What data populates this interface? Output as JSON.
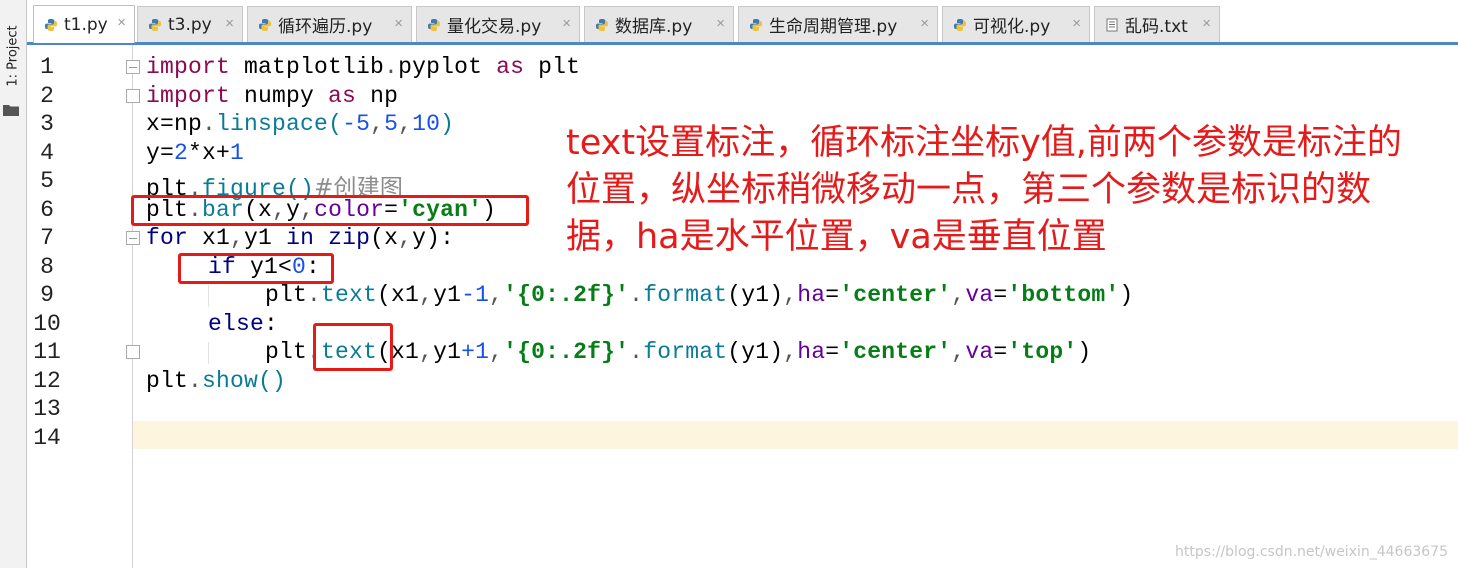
{
  "toolstrip": {
    "project_label": "1: Project"
  },
  "tabs": [
    {
      "label": "t1.py",
      "active": true,
      "icon": "python-file-icon"
    },
    {
      "label": "t3.py",
      "active": false,
      "icon": "python-file-icon"
    },
    {
      "label": "循环遍历.py",
      "active": false,
      "icon": "python-file-icon"
    },
    {
      "label": "量化交易.py",
      "active": false,
      "icon": "python-file-icon"
    },
    {
      "label": "数据库.py",
      "active": false,
      "icon": "python-file-icon"
    },
    {
      "label": "生命周期管理.py",
      "active": false,
      "icon": "python-file-icon"
    },
    {
      "label": "可视化.py",
      "active": false,
      "icon": "python-file-icon"
    },
    {
      "label": "乱码.txt",
      "active": false,
      "icon": "text-file-icon"
    }
  ],
  "tab_close_glyph": "×",
  "line_numbers": [
    "1",
    "2",
    "3",
    "4",
    "5",
    "6",
    "7",
    "8",
    "9",
    "10",
    "11",
    "12",
    "13",
    "14"
  ],
  "code": {
    "l1": {
      "kw": "import",
      "mod": " matplotlib",
      "dot": ".",
      "mod2": "pyplot ",
      "as": "as",
      "alias": " plt"
    },
    "l2": {
      "kw": "import",
      "mod": " numpy ",
      "as": "as",
      "alias": " np"
    },
    "l3": {
      "a": "x=np",
      "dot": ".",
      "fn": "linspace",
      "op": "(",
      "n1": "-5",
      "c1": ",",
      "n2": "5",
      "c2": ",",
      "n3": "10",
      "cl": ")"
    },
    "l4": {
      "a": "y=",
      "n1": "2",
      "b": "*x+",
      "n2": "1"
    },
    "l5": {
      "a": "plt",
      "dot": ".",
      "fn": "figure",
      "p": "()",
      "cmt": "#创建图"
    },
    "l6": {
      "a": "plt",
      "dot": ".",
      "fn": "bar",
      "p1": "(x",
      "c1": ",",
      "b": "y",
      "c2": ",",
      "param": "color",
      "eq": "=",
      "str": "'cyan'",
      "cl": ")"
    },
    "l7": {
      "kw": "for",
      "a": " x1",
      "c1": ",",
      "b": "y1 ",
      "kw2": "in",
      "fn": " zip",
      "p": "(x",
      "c2": ",",
      "d": "y",
      "cl": "):"
    },
    "l8": {
      "kw": "if",
      "a": " y1<",
      "n": "0",
      "cl": ":"
    },
    "l9": {
      "a": "plt",
      "dot": ".",
      "fn": "text",
      "p": "(x1",
      "c1": ",",
      "b": "y1",
      "op": "-",
      "n": "1",
      "c2": ",",
      "str": "'{0:.2f}'",
      "dot2": ".",
      "fn2": "format",
      "p2": "(y1)",
      "c3": ",",
      "param1": "ha",
      "eq1": "=",
      "str2": "'center'",
      "c4": ",",
      "param2": "va",
      "eq2": "=",
      "str3": "'bottom'",
      "cl": ")"
    },
    "l10": {
      "kw": "else",
      "cl": ":"
    },
    "l11": {
      "a": "plt",
      "dot": ".",
      "fn": "text",
      "p": "(x1",
      "c1": ",",
      "b": "y1",
      "op": "+",
      "n": "1",
      "c2": ",",
      "str": "'{0:.2f}'",
      "dot2": ".",
      "fn2": "format",
      "p2": "(y1)",
      "c3": ",",
      "param1": "ha",
      "eq1": "=",
      "str2": "'center'",
      "c4": ",",
      "param2": "va",
      "eq2": "=",
      "str3": "'top'",
      "cl": ")"
    },
    "l12": {
      "a": "plt",
      "dot": ".",
      "fn": "show",
      "p": "()"
    }
  },
  "annotation": {
    "line1": "text设置标注，循环标注坐标y值,前两个参数是标注的",
    "line2": "位置，纵坐标稍微移动一点，第三个参数是标识的数",
    "line3": "据，ha是水平位置，va是垂直位置"
  },
  "colors": {
    "highlight": "#e41b17",
    "annotation": "#e51b1b",
    "current_line": "#fdf5dd",
    "tab_accent": "#4a88c7"
  },
  "watermark": "https://blog.csdn.net/weixin_44663675"
}
